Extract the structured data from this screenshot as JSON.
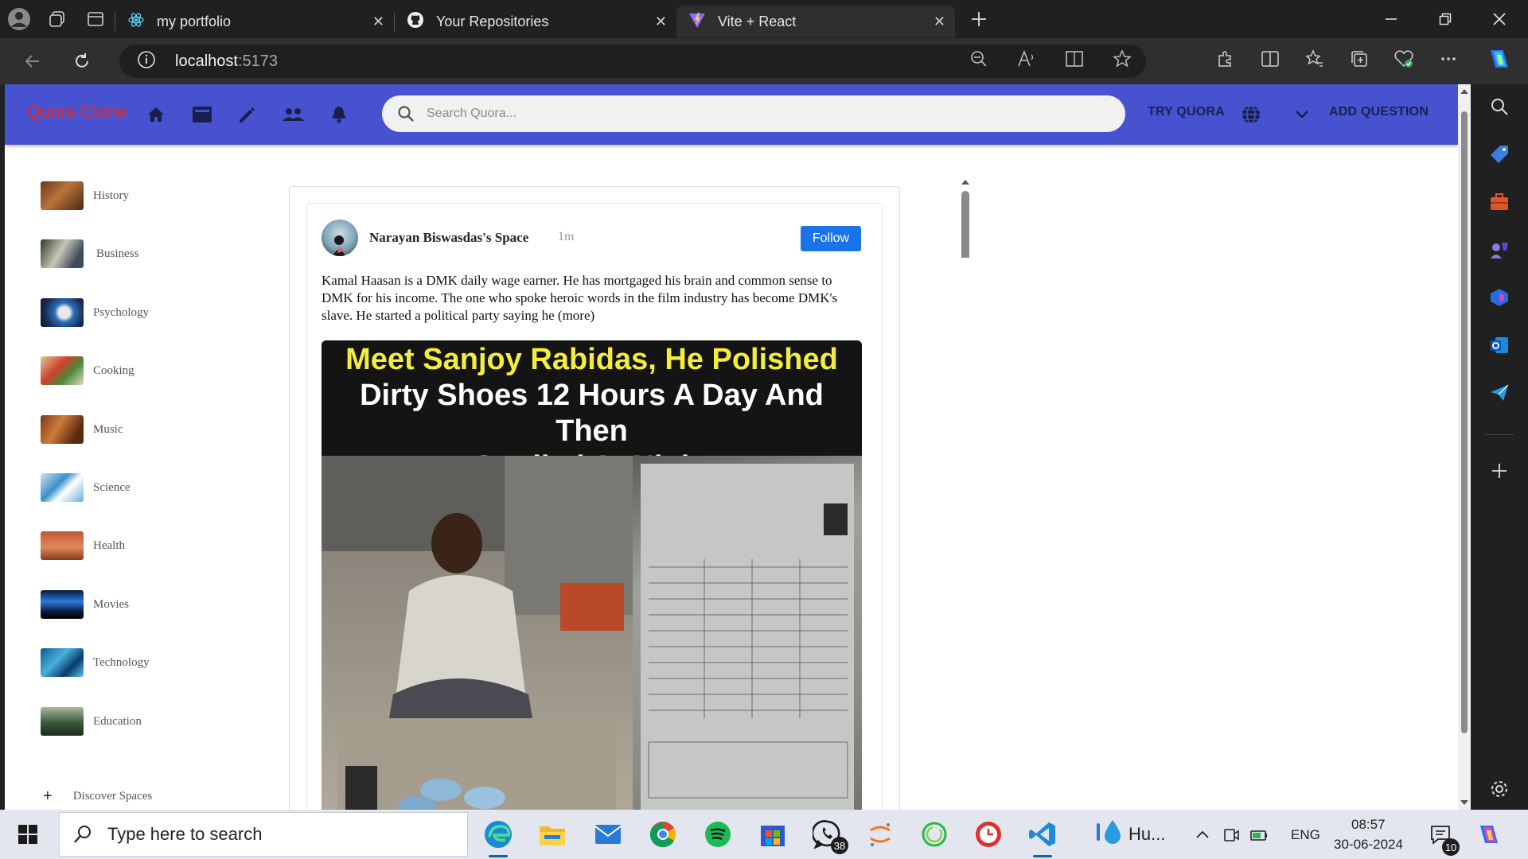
{
  "browser": {
    "tabs": [
      {
        "title": "my portfolio",
        "icon": "react-icon"
      },
      {
        "title": "Your Repositories",
        "icon": "github-icon"
      },
      {
        "title": "Vite + React",
        "icon": "vite-icon"
      }
    ],
    "active_tab": 2,
    "url_host": "localhost",
    "url_port": ":5173"
  },
  "header": {
    "logo": "Quora Clone",
    "search_placeholder": "Search Quora...",
    "try_label": "TRY QUORA",
    "add_question_label": "ADD QUESTION",
    "nav_icons": [
      "home-icon",
      "following-icon",
      "answer-icon",
      "spaces-icon",
      "notifications-icon"
    ]
  },
  "sidebar": {
    "items": [
      {
        "label": "History"
      },
      {
        "label": "Business"
      },
      {
        "label": "Psychology"
      },
      {
        "label": "Cooking"
      },
      {
        "label": "Music"
      },
      {
        "label": "Science"
      },
      {
        "label": "Health"
      },
      {
        "label": "Movies"
      },
      {
        "label": "Technology"
      },
      {
        "label": "Education"
      }
    ],
    "discover_label": "Discover Spaces"
  },
  "post": {
    "author": "Narayan Biswasdas's Space",
    "time": "1m",
    "follow_label": "Follow",
    "text": "Kamal Haasan is a DMK daily wage earner. He has mortgaged his brain and common sense to DMK for his income. The one who spoke heroic words in the film industry has become DMK's slave. He started a political party saying he (more)",
    "image_caption_line1": "Meet Sanjoy Rabidas, He Polished",
    "image_caption_line2": "Dirty Shoes 12 Hours A Day And Then",
    "image_caption_line3": "Studied At Night"
  },
  "taskbar": {
    "search_placeholder": "Type here to search",
    "whatsapp_badge": "38",
    "weather_label": "Hu...",
    "language": "ENG",
    "time": "08:57",
    "date": "30-06-2024",
    "notification_count": "10"
  },
  "colors": {
    "header_bg": "#4652d0",
    "logo": "#e0292b",
    "follow_button": "#1a73e8"
  }
}
